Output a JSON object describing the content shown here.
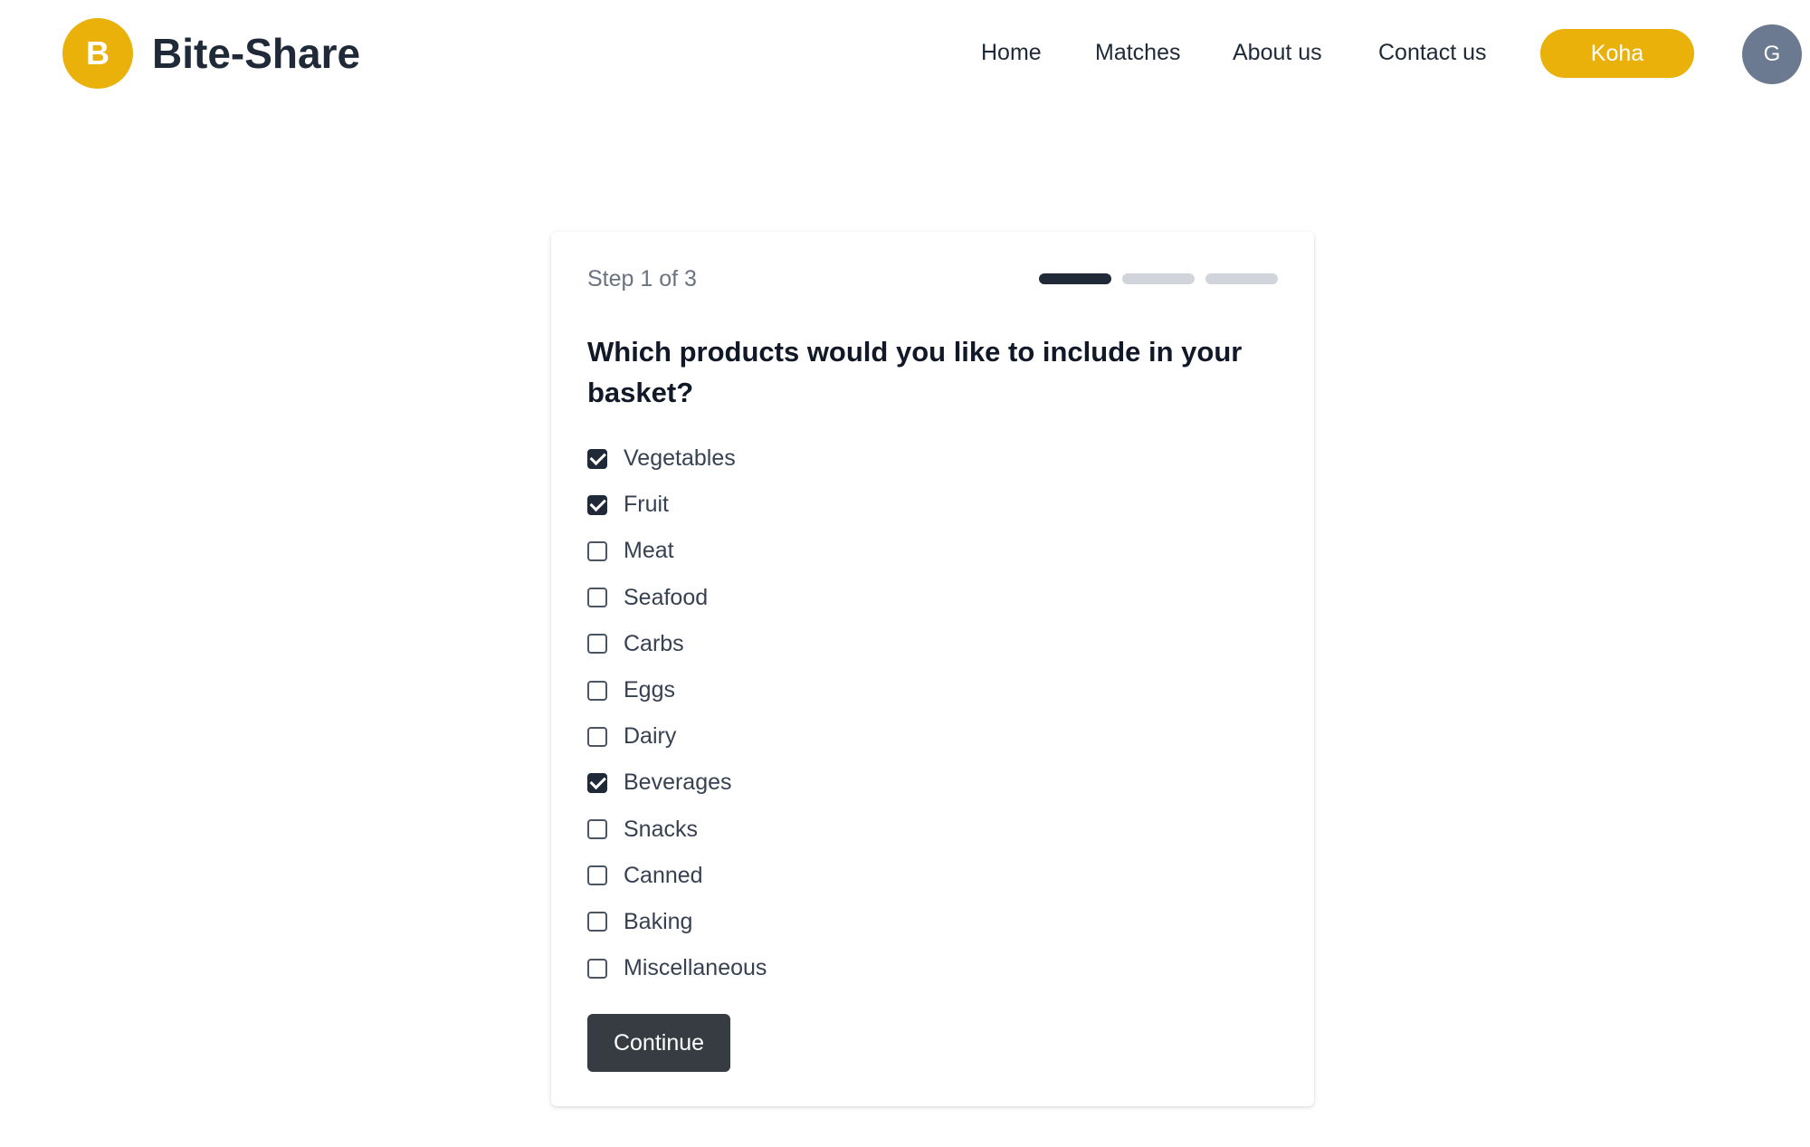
{
  "brand": {
    "logo_letter": "B",
    "name": "Bite-Share",
    "color": "#e9b10a"
  },
  "nav": {
    "items": [
      {
        "label": "Home"
      },
      {
        "label": "Matches"
      },
      {
        "label": "About us"
      },
      {
        "label": "Contact us"
      }
    ],
    "koha_label": "Koha",
    "avatar_letter": "G"
  },
  "wizard": {
    "step_label": "Step 1 of 3",
    "current_step": 1,
    "total_steps": 3,
    "question": "Which products would you like to include in your basket?",
    "options": [
      {
        "label": "Vegetables",
        "checked": true
      },
      {
        "label": "Fruit",
        "checked": true
      },
      {
        "label": "Meat",
        "checked": false
      },
      {
        "label": "Seafood",
        "checked": false
      },
      {
        "label": "Carbs",
        "checked": false
      },
      {
        "label": "Eggs",
        "checked": false
      },
      {
        "label": "Dairy",
        "checked": false
      },
      {
        "label": "Beverages",
        "checked": true
      },
      {
        "label": "Snacks",
        "checked": false
      },
      {
        "label": "Canned",
        "checked": false
      },
      {
        "label": "Baking",
        "checked": false
      },
      {
        "label": "Miscellaneous",
        "checked": false
      }
    ],
    "continue_label": "Continue"
  },
  "colors": {
    "accent": "#e9b10a",
    "progress_active": "#1f2937",
    "progress_inactive": "#d1d5db",
    "button_dark": "#373c43",
    "avatar": "#6b7a90"
  }
}
